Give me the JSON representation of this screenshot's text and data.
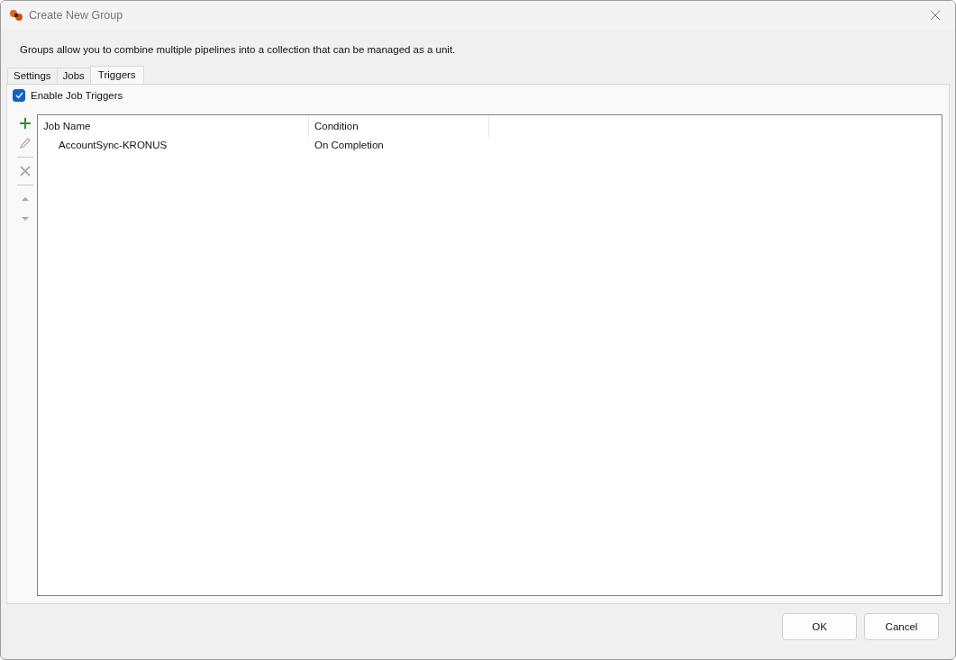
{
  "window": {
    "title": "Create New Group"
  },
  "description": "Groups allow you to combine multiple pipelines into a collection that can be managed as a unit.",
  "tabs": [
    {
      "label": "Settings",
      "selected": false
    },
    {
      "label": "Jobs",
      "selected": false
    },
    {
      "label": "Triggers",
      "selected": true
    }
  ],
  "enable_triggers": {
    "label": "Enable Job Triggers",
    "checked": true
  },
  "toolbar": [
    [
      {
        "kind": "add",
        "disabled": false
      },
      {
        "kind": "edit",
        "disabled": true
      }
    ],
    [
      {
        "kind": "delete",
        "disabled": true
      }
    ],
    [
      {
        "kind": "up",
        "disabled": true
      },
      {
        "kind": "down",
        "disabled": true
      }
    ]
  ],
  "table": {
    "columns": [
      "Job Name",
      "Condition"
    ],
    "rows": [
      {
        "cells": [
          "AccountSync-KRONUS",
          "On Completion"
        ],
        "selected": false
      }
    ]
  },
  "buttons": [
    "OK",
    "Cancel"
  ]
}
